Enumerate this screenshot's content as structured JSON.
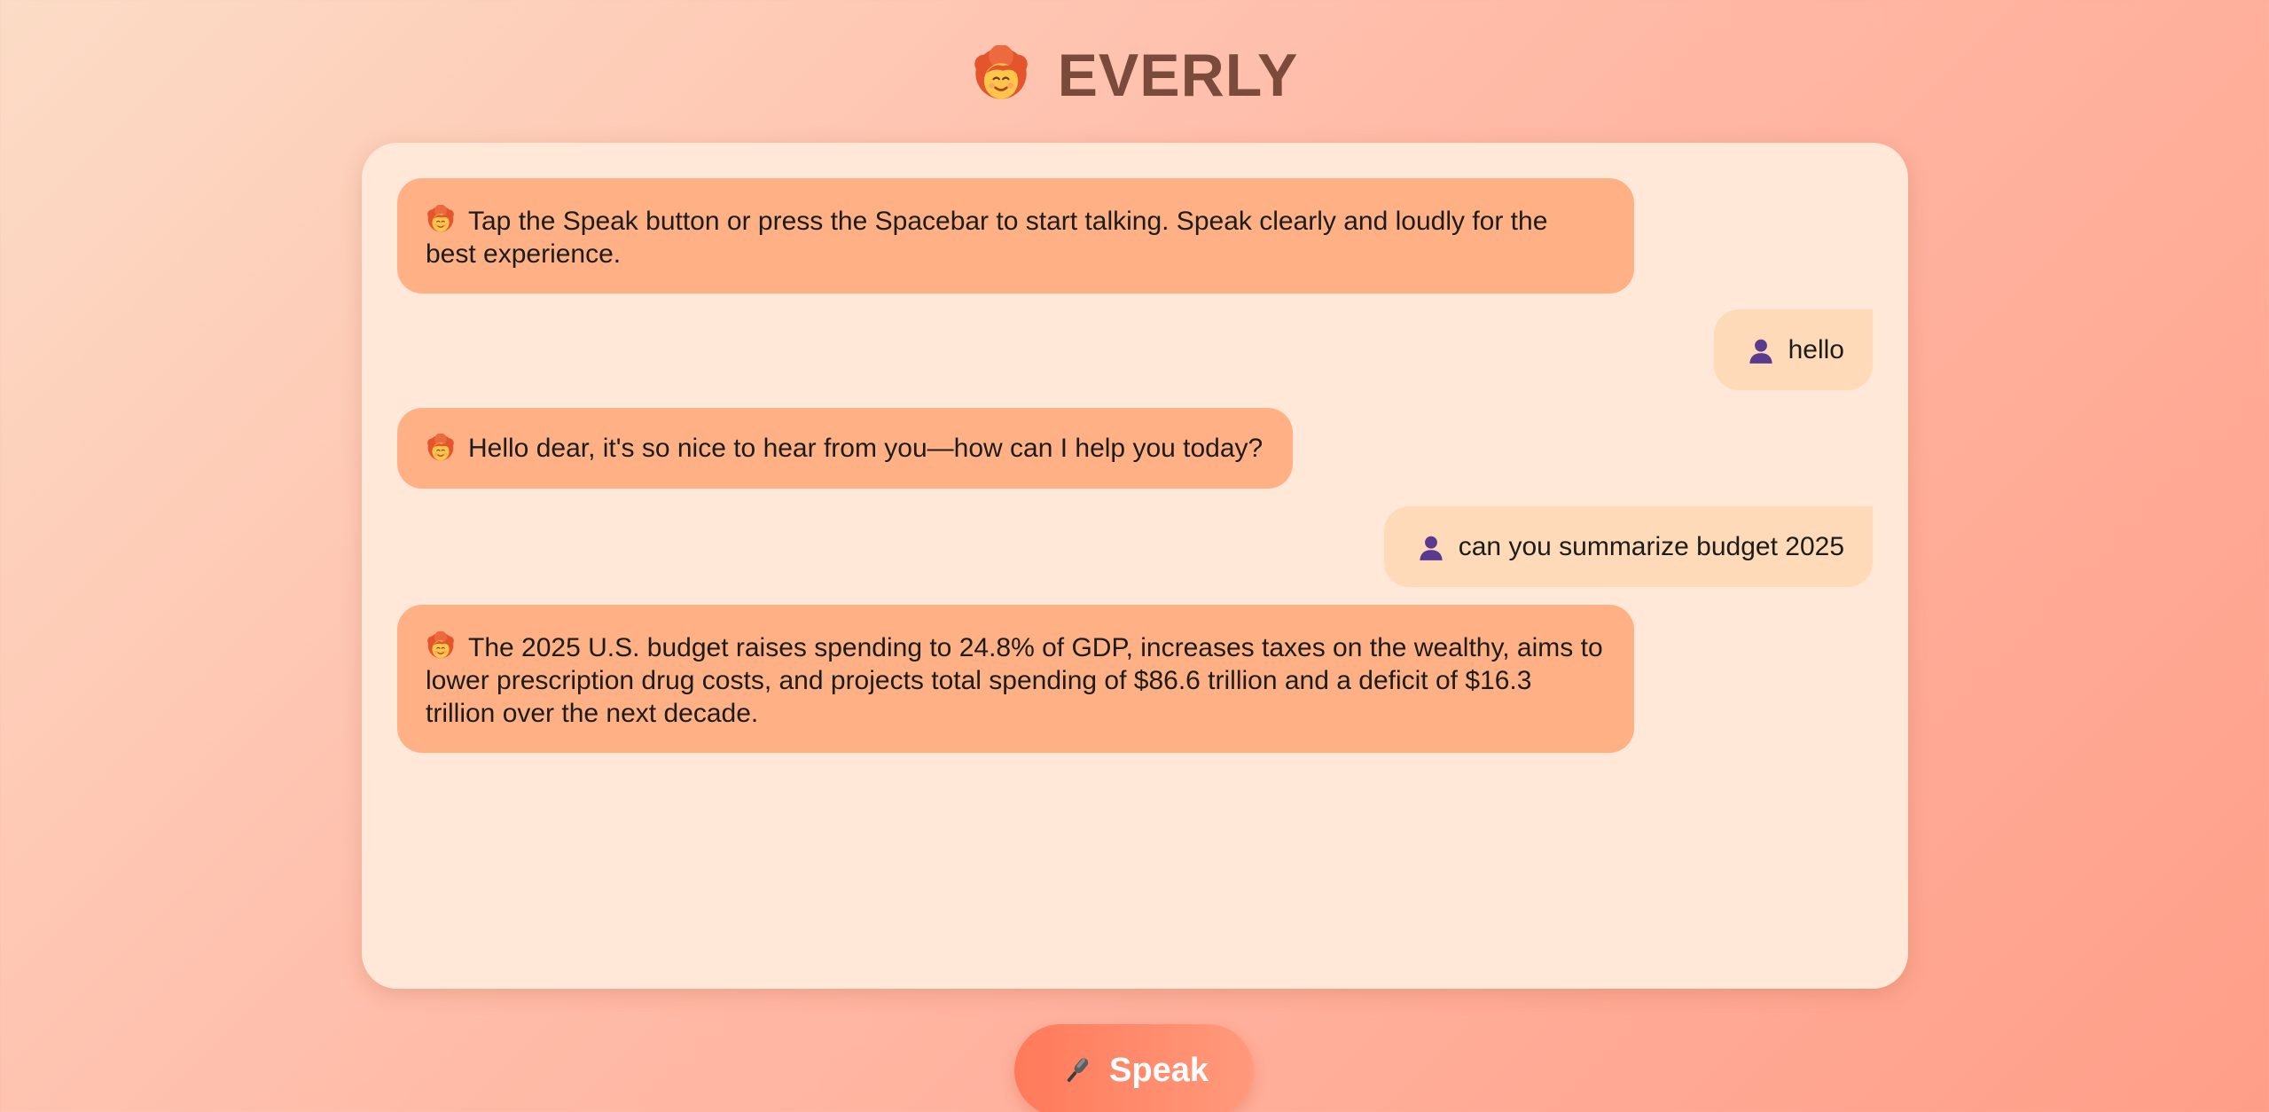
{
  "app": {
    "title": "EVERLY",
    "logo_icon": "woman-face-icon"
  },
  "messages": [
    {
      "role": "assistant",
      "icon": "woman-face-icon",
      "text": "Tap the Speak button or press the Spacebar to start talking. Speak clearly and loudly for the best experience."
    },
    {
      "role": "user",
      "icon": "user-silhouette-icon",
      "text": "hello"
    },
    {
      "role": "assistant",
      "icon": "woman-face-icon",
      "text": "Hello dear, it's so nice to hear from you—how can I help you today?"
    },
    {
      "role": "user",
      "icon": "user-silhouette-icon",
      "text": "can you summarize budget 2025"
    },
    {
      "role": "assistant",
      "icon": "woman-face-icon",
      "text": "The 2025 U.S. budget raises spending to 24.8% of GDP, increases taxes on the wealthy, aims to lower prescription drug costs, and projects total spending of $86.6 trillion and a deficit of $16.3 trillion over the next decade."
    }
  ],
  "speak_button": {
    "label": "Speak",
    "icon": "microphone-icon"
  },
  "colors": {
    "assistant_bubble": "#ffb185",
    "user_bubble": "#ffdab8",
    "panel": "#ffe8d8",
    "title": "#7a4b3a",
    "button": "#ff7a5a"
  }
}
